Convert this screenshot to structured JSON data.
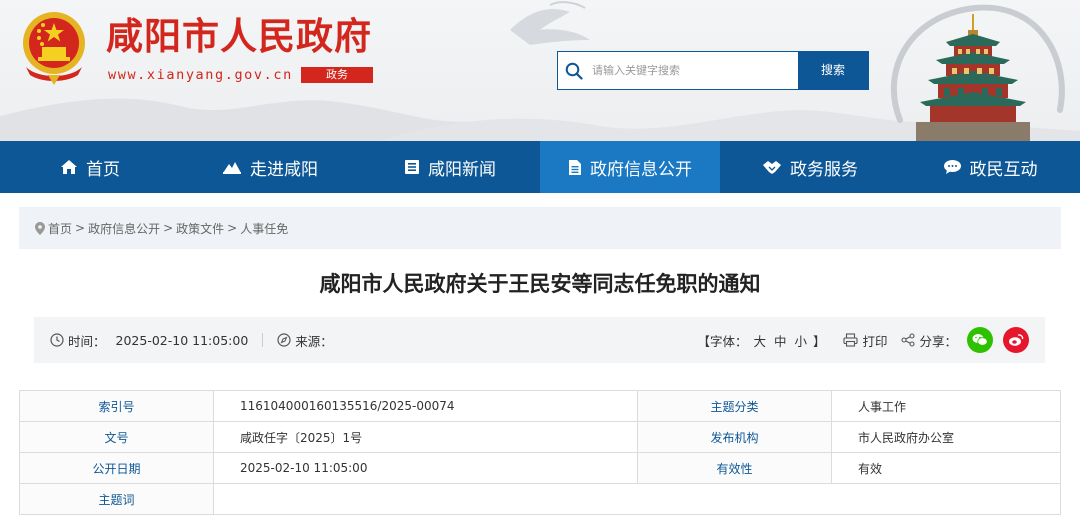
{
  "header": {
    "site_title": "咸阳市人民政府",
    "site_url": "www.xianyang.gov.cn",
    "site_badge": "政务",
    "search": {
      "placeholder": "请输入关键字搜索",
      "button_label": "搜索"
    }
  },
  "nav": {
    "items": [
      {
        "label": "首页",
        "icon": "home-icon",
        "active": false
      },
      {
        "label": "走进咸阳",
        "icon": "mountain-icon",
        "active": false
      },
      {
        "label": "咸阳新闻",
        "icon": "news-icon",
        "active": false
      },
      {
        "label": "政府信息公开",
        "icon": "document-icon",
        "active": true
      },
      {
        "label": "政务服务",
        "icon": "handshake-icon",
        "active": false
      },
      {
        "label": "政民互动",
        "icon": "chat-icon",
        "active": false
      }
    ]
  },
  "breadcrumb": [
    "首页",
    "政府信息公开",
    "政策文件",
    "人事任免"
  ],
  "breadcrumb_separator": ">",
  "article": {
    "title": "咸阳市人民政府关于王民安等同志任免职的通知",
    "time_label": "时间：",
    "time_value": "2025-02-10 11:05:00",
    "source_label": "来源：",
    "font_size_prefix": "【字体：",
    "font_large": "大",
    "font_medium": "中",
    "font_small": "小",
    "font_size_suffix": "】",
    "print_label": "打印",
    "share_label": "分享："
  },
  "info_table": {
    "rows": [
      {
        "label1": "索引号",
        "value1": "116104000160135516/2025-00074",
        "label2": "主题分类",
        "value2": "人事工作"
      },
      {
        "label1": "文号",
        "value1": "咸政任字〔2025〕1号",
        "label2": "发布机构",
        "value2": "市人民政府办公室"
      },
      {
        "label1": "公开日期",
        "value1": "2025-02-10 11:05:00",
        "label2": "有效性",
        "value2": "有效"
      }
    ],
    "keyword_label": "主题词",
    "keyword_value": ""
  },
  "colors": {
    "brand_red": "#d3261c",
    "nav_blue": "#0d5796",
    "nav_active": "#1b79c4",
    "wechat_green": "#2dc100",
    "weibo_red": "#e6162d"
  }
}
